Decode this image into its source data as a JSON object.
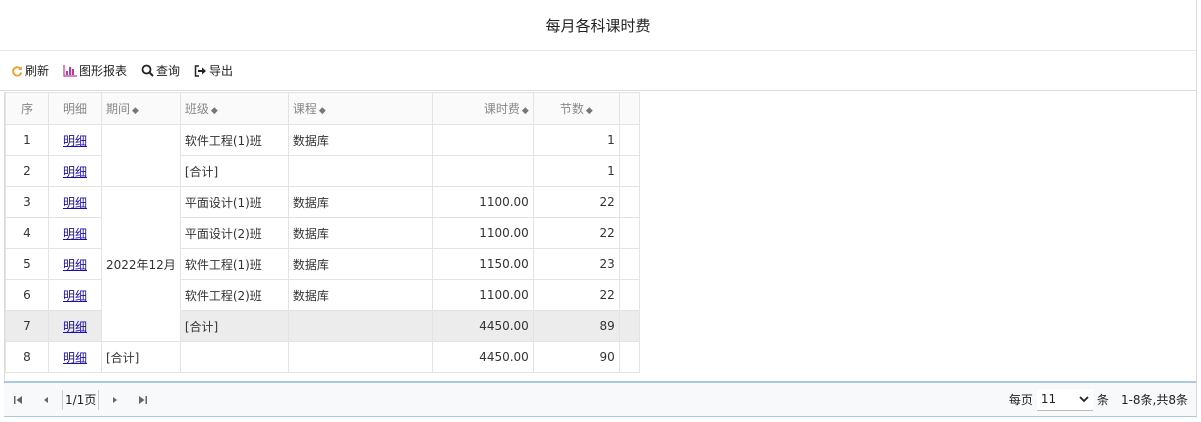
{
  "title": "每月各科课时费",
  "toolbar": {
    "refresh": "刷新",
    "chart": "图形报表",
    "query": "查询",
    "export": "导出"
  },
  "colors": {
    "refresh_icon": "#f0a020",
    "chart_icon": "#c0359a",
    "link": "#1a0dab",
    "pager_border": "#a8c8e6"
  },
  "table": {
    "headers": {
      "seq": "序",
      "detail": "明细",
      "period": "期间",
      "class": "班级",
      "course": "课程",
      "fee": "课时费",
      "lessons": "节数"
    },
    "period_value": "2022年12月",
    "rows": [
      {
        "seq": "1",
        "detail": "明细",
        "period": "",
        "class": "软件工程(1)班",
        "course": "数据库",
        "fee": "",
        "lessons": "1"
      },
      {
        "seq": "2",
        "detail": "明细",
        "period": "",
        "class": "[合计]",
        "course": "",
        "fee": "",
        "lessons": "1"
      },
      {
        "seq": "3",
        "detail": "明细",
        "period": "",
        "class": "平面设计(1)班",
        "course": "数据库",
        "fee": "1100.00",
        "lessons": "22"
      },
      {
        "seq": "4",
        "detail": "明细",
        "period": "",
        "class": "平面设计(2)班",
        "course": "数据库",
        "fee": "1100.00",
        "lessons": "22"
      },
      {
        "seq": "5",
        "detail": "明细",
        "period": "2022年12月",
        "class": "软件工程(1)班",
        "course": "数据库",
        "fee": "1150.00",
        "lessons": "23"
      },
      {
        "seq": "6",
        "detail": "明细",
        "period": "",
        "class": "软件工程(2)班",
        "course": "数据库",
        "fee": "1100.00",
        "lessons": "22"
      },
      {
        "seq": "7",
        "detail": "明细",
        "period": "",
        "class": "[合计]",
        "course": "",
        "fee": "4450.00",
        "lessons": "89"
      },
      {
        "seq": "8",
        "detail": "明细",
        "period": "[合计]",
        "class": "",
        "course": "",
        "fee": "4450.00",
        "lessons": "90"
      }
    ]
  },
  "pager": {
    "page_label": "1/1页",
    "per_page_label": "每页",
    "per_page_value": "11",
    "unit": "条",
    "summary": "1-8条,共8条"
  }
}
